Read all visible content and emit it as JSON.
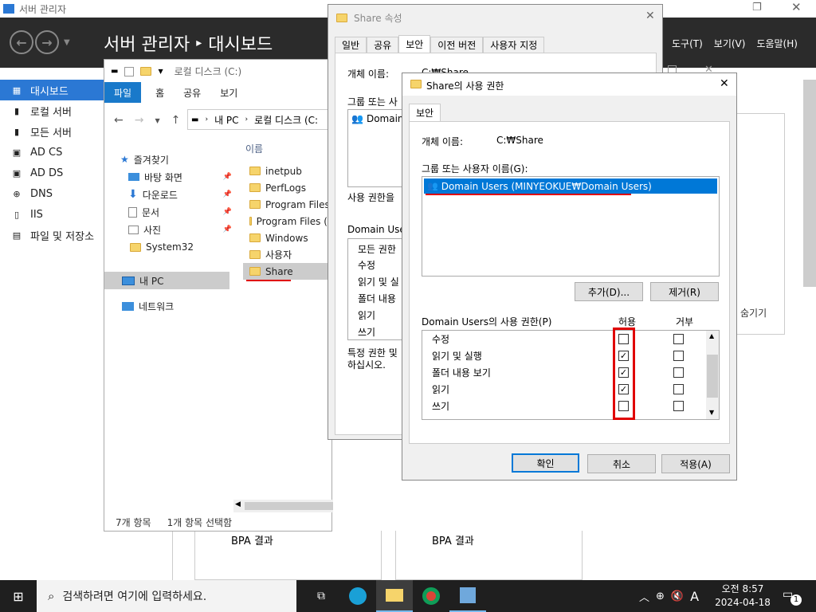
{
  "sm": {
    "window_title": "서버 관리자",
    "breadcrumb_a": "서버 관리자",
    "breadcrumb_sep": "▸",
    "breadcrumb_b": "대시보드",
    "menu": [
      "도구(T)",
      "보기(V)",
      "도움말(H)"
    ],
    "sidebar": [
      "대시보드",
      "로컬 서버",
      "모든 서버",
      "AD CS",
      "AD DS",
      "DNS",
      "IIS",
      "파일 및 저장소"
    ],
    "bpa1": "BPA 결과",
    "bpa2": "BPA 결과",
    "hide": "숨기기"
  },
  "explorer": {
    "title": "로컬 디스크 (C:)",
    "ribbon": [
      "파일",
      "홈",
      "공유",
      "보기"
    ],
    "path": [
      "내 PC",
      "로컬 디스크 (C:"
    ],
    "col_name": "이름",
    "nav": [
      {
        "label": "즐겨찾기",
        "icon": "star-icon"
      },
      {
        "label": "바탕 화면",
        "icon": "desktop-icon"
      },
      {
        "label": "다운로드",
        "icon": "download-icon"
      },
      {
        "label": "문서",
        "icon": "document-icon"
      },
      {
        "label": "사진",
        "icon": "picture-icon"
      },
      {
        "label": "System32",
        "icon": "folder-icon"
      },
      {
        "label": "내 PC",
        "icon": "pc-icon"
      },
      {
        "label": "네트워크",
        "icon": "network-icon"
      }
    ],
    "files": [
      "inetpub",
      "PerfLogs",
      "Program Files",
      "Program Files (x",
      "Windows",
      "사용자",
      "Share"
    ],
    "status_count": "7개 항목",
    "status_sel": "1개 항목 선택함"
  },
  "props": {
    "title": "Share 속성",
    "tabs": [
      "일반",
      "공유",
      "보안",
      "이전 버전",
      "사용자 지정"
    ],
    "object_label": "개체 이름:",
    "object_value": "C:₩Share",
    "group_label": "그룹 또는 사",
    "group_item": "Domain",
    "perm_change": "사용 권한을",
    "perm_for": "Domain User",
    "perms": [
      "모든 권한",
      "수정",
      "읽기 및 실",
      "폴더 내용",
      "읽기",
      "쓰기"
    ],
    "special": "특정 권한 및",
    "special2": "하십시오."
  },
  "perm": {
    "title": "Share의 사용 권한",
    "tab": "보안",
    "object_label": "개체 이름:",
    "object_value": "C:₩Share",
    "group_label": "그룹 또는 사용자 이름(G):",
    "group_item": "Domain Users (MINYEOKUE₩Domain Users)",
    "add": "추가(D)...",
    "remove": "제거(R)",
    "perm_label": "Domain Users의 사용 권한(P)",
    "allow": "허용",
    "deny": "거부",
    "rows": [
      {
        "name": "수정",
        "allow": false,
        "deny": false
      },
      {
        "name": "읽기 및 실행",
        "allow": true,
        "deny": false
      },
      {
        "name": "폴더 내용 보기",
        "allow": true,
        "deny": false
      },
      {
        "name": "읽기",
        "allow": true,
        "deny": false
      },
      {
        "name": "쓰기",
        "allow": false,
        "deny": false
      }
    ],
    "ok": "확인",
    "cancel": "취소",
    "apply": "적용(A)",
    "highlight_color": "#e00000"
  },
  "taskbar": {
    "search": "검색하려면 여기에 입력하세요.",
    "time": "오전 8:57",
    "date": "2024-04-18",
    "ime": "A",
    "notif": "1"
  }
}
